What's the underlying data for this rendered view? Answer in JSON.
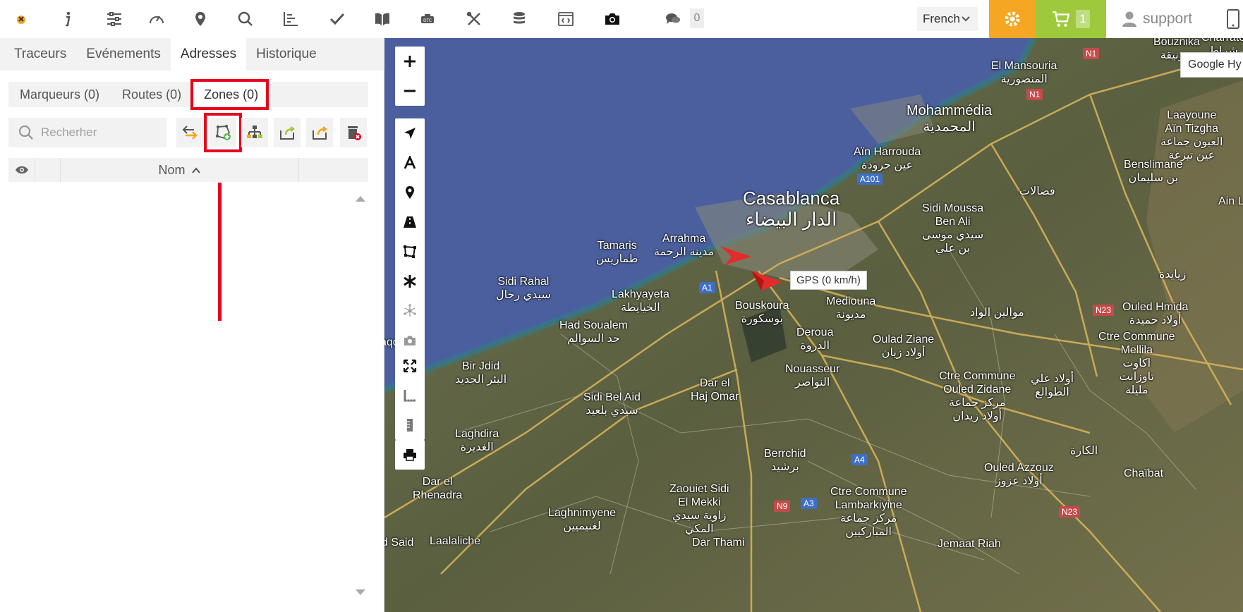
{
  "toolbar": {
    "chat_count": "0",
    "language": "French",
    "cart_count": "1",
    "user": "support",
    "icons": [
      "logo-icon",
      "info-icon",
      "sliders-icon",
      "dashboard-icon",
      "location-pin-icon",
      "search-icon",
      "chart-icon",
      "check-icon",
      "book-icon",
      "dtc-icon",
      "tools-icon",
      "coins-icon",
      "code-window-icon",
      "camera-icon",
      "chat-icon"
    ]
  },
  "left_panel": {
    "main_tabs": [
      {
        "label": "Traceurs"
      },
      {
        "label": "Evénements"
      },
      {
        "label": "Adresses"
      },
      {
        "label": "Historique"
      }
    ],
    "sub_tabs": [
      {
        "label": "Marqueurs (0)"
      },
      {
        "label": "Routes (0)"
      },
      {
        "label": "Zones (0)"
      }
    ],
    "search_placeholder": "Recherher",
    "grid": {
      "column_name": "Nom"
    }
  },
  "map": {
    "gps_tooltip": "GPS (0 km/h)",
    "google_label": "Google Hy",
    "labels": {
      "bouznika": "Bouznika",
      "bouznika_ar": "بوزنيقة",
      "charrate": "Charrate",
      "charrate_ar": "شراط",
      "mansouria": "El Mansouria",
      "mansouria_ar": "المنصورية",
      "mohammedia": "Mohammédia",
      "mohammedia_ar": "المحمدية",
      "ain_harrouda": "Aïn Harrouda",
      "ain_harrouda_ar": "عين حرودة",
      "laayoune": "Laayoune",
      "ain_tizgha": "Aïn Tizgha",
      "laayoune_ar": "العيون جماعة",
      "ain_tizgha_ar": "عين تيزغة",
      "benslimane": "Benslimane",
      "benslimane_ar": "بن سليمان",
      "fedalate_ar": "فضالات",
      "ain_label": "Ain L",
      "casablanca": "Casablanca",
      "casablanca_ar": "الدار البيضاء",
      "sidi_moussa": "Sidi Moussa",
      "ben_ali": "Ben Ali",
      "sidi_moussa_ar": "سيدي موسى",
      "ben_ali_ar": "بن علي",
      "tamaris": "Tamaris",
      "tamaris_ar": "طماريس",
      "arrahma": "Arrahma",
      "arrahma_ar": "مدينة الرحمة",
      "sidi_rahal": "Sidi Rahal",
      "sidi_rahal_ar": "سيدي رحال",
      "ziaida_ar": "زيايدة",
      "lakhyayeta": "Lakhyayeta",
      "lakhyayeta_ar": "الخيايطة",
      "bouskoura": "Bouskoura",
      "bouskoura_ar": "بوسكورة",
      "mediouna": "Mediouna",
      "mediouna_ar": "مديونة",
      "mouwalin_ar": "موالين الواد",
      "ouled_hmida": "Ouled Hmida",
      "ouled_hmida_ar": "أولاد حميدة",
      "had_soualem": "Had Soualem",
      "had_soualem_ar": "حد السوالم",
      "deroua": "Deroua",
      "deroua_ar": "الدروة",
      "oulad_ziane": "Oulad Ziane",
      "oulad_ziane_ar": "أولاد زيان",
      "ctre_mellila": "Ctre Commune",
      "mellila": "Mellila",
      "mellila_ar": "اكاوت",
      "mellila_ar2": "تاوزانت",
      "mellila_ar3": "مليلة",
      "aqoub": "aqoub",
      "bir_jdid": "Bir Jdid",
      "bir_jdid_ar": "البئر الجديد",
      "nouasseur": "Nouasseur",
      "nouasseur_ar": "النواصر",
      "ctre_zidane": "Ctre Commune",
      "ouled_zidane": "Ouled Zidane",
      "ctre_zidane_ar": "مركز جماعة",
      "ouled_zidane_ar": "أولاد زيدان",
      "oulad_ali_ar": "أولاد علي",
      "oulad_ali_ar2": "الطوالع",
      "dar_el": "Dar el",
      "haj_omar": "Haj Omar",
      "sidi_bel_aid": "Sidi Bel Aid",
      "sidi_bel_aid_ar": "سيدي بلعيد",
      "laghdira": "Laghdira",
      "laghdira_ar": "الغديرة",
      "berrchid": "Berrchid",
      "berrchid_ar": "برشيد",
      "lagara_ar": "الكارة",
      "ouled_azzouz": "Ouled Azzouz",
      "ouled_azzouz_ar": "أولاد عزوز",
      "chaibat": "Chaïbat",
      "dar_rhenadra": "Dar el",
      "rhenadra": "Rhenadra",
      "zaouiet": "Zaouiet Sidi",
      "el_mekki": "El Mekki",
      "zaouiet_ar": "زاوية سيدي",
      "el_mekki_ar": "المكي",
      "ctre_lamb": "Ctre Commune",
      "lambarkiyine": "Lambarkiyine",
      "ctre_lamb_ar": "مركز جماعة",
      "lambarkiyine_ar": "المباركيين",
      "laghnimyene": "Laghnimyene",
      "laghnimyene_ar": "لغنيميين",
      "laalaliche": "Laalaliche",
      "dar_thami": "Dar Thami",
      "ouled_said": "d Said",
      "jemaat": "Jemaat Riah"
    },
    "roads": [
      "N1",
      "N1",
      "A101",
      "A1",
      "N23",
      "A4",
      "N9",
      "A3",
      "N23"
    ]
  },
  "colors": {
    "accent_orange": "#f5a623",
    "accent_green": "#9fc93c",
    "highlight_red": "#e8001c",
    "sea": "#4b5f9e"
  }
}
